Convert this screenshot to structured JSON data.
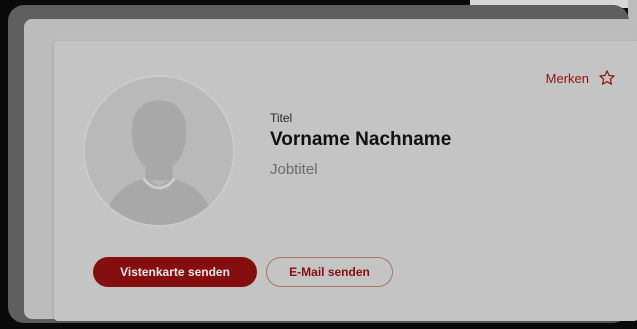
{
  "card": {
    "bookmark": {
      "label": "Merken",
      "icon": "star-outline-icon"
    },
    "avatar": {
      "icon": "user-placeholder-icon"
    },
    "profile": {
      "salutation": "Titel",
      "full_name": "Vorname Nachname",
      "job_title": "Jobtitel"
    },
    "actions": {
      "send_vcard_label": "Vistenkarte senden",
      "send_email_label": "E-Mail senden"
    }
  },
  "colors": {
    "accent": "#850f0f",
    "card_background": "#c4c4c4",
    "frame": "#5e5e5e",
    "page_background": "#0a0a0a"
  }
}
